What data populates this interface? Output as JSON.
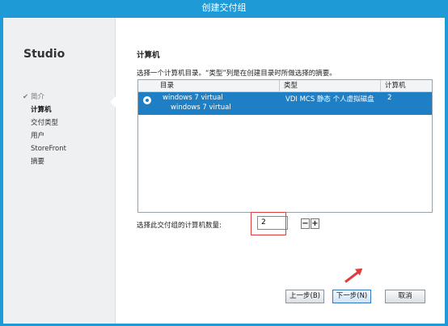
{
  "window": {
    "title": "创建交付组"
  },
  "sidebar": {
    "brand": "Studio",
    "steps": [
      {
        "label": "简介",
        "status": "done"
      },
      {
        "label": "计算机",
        "status": "current"
      },
      {
        "label": "交付类型",
        "status": "pending"
      },
      {
        "label": "用户",
        "status": "pending"
      },
      {
        "label": "StoreFront",
        "status": "pending"
      },
      {
        "label": "摘要",
        "status": "pending"
      }
    ]
  },
  "main": {
    "section_title": "计算机",
    "instruction": "选择一个计算机目录。“类型”列是在创建目录时所做选择的摘要。",
    "table": {
      "columns": [
        "目录",
        "类型",
        "计算机"
      ],
      "rows": [
        {
          "catalog_name": "windows 7 virtual",
          "catalog_desc": "windows 7 virtual",
          "type": "VDI MCS 静态 个人虚拟磁盘",
          "machines": "2",
          "selected": true
        }
      ]
    },
    "count_label": "选择此交付组的计算机数量:",
    "count_value": "2",
    "minus_label": "−",
    "plus_label": "+"
  },
  "buttons": {
    "back": "上一步(B)",
    "next": "下一步(N)",
    "cancel": "取消"
  },
  "colors": {
    "title_bar": "#1e9bd7",
    "selection": "#1f7fc5",
    "annotation": "#e23b3b"
  }
}
